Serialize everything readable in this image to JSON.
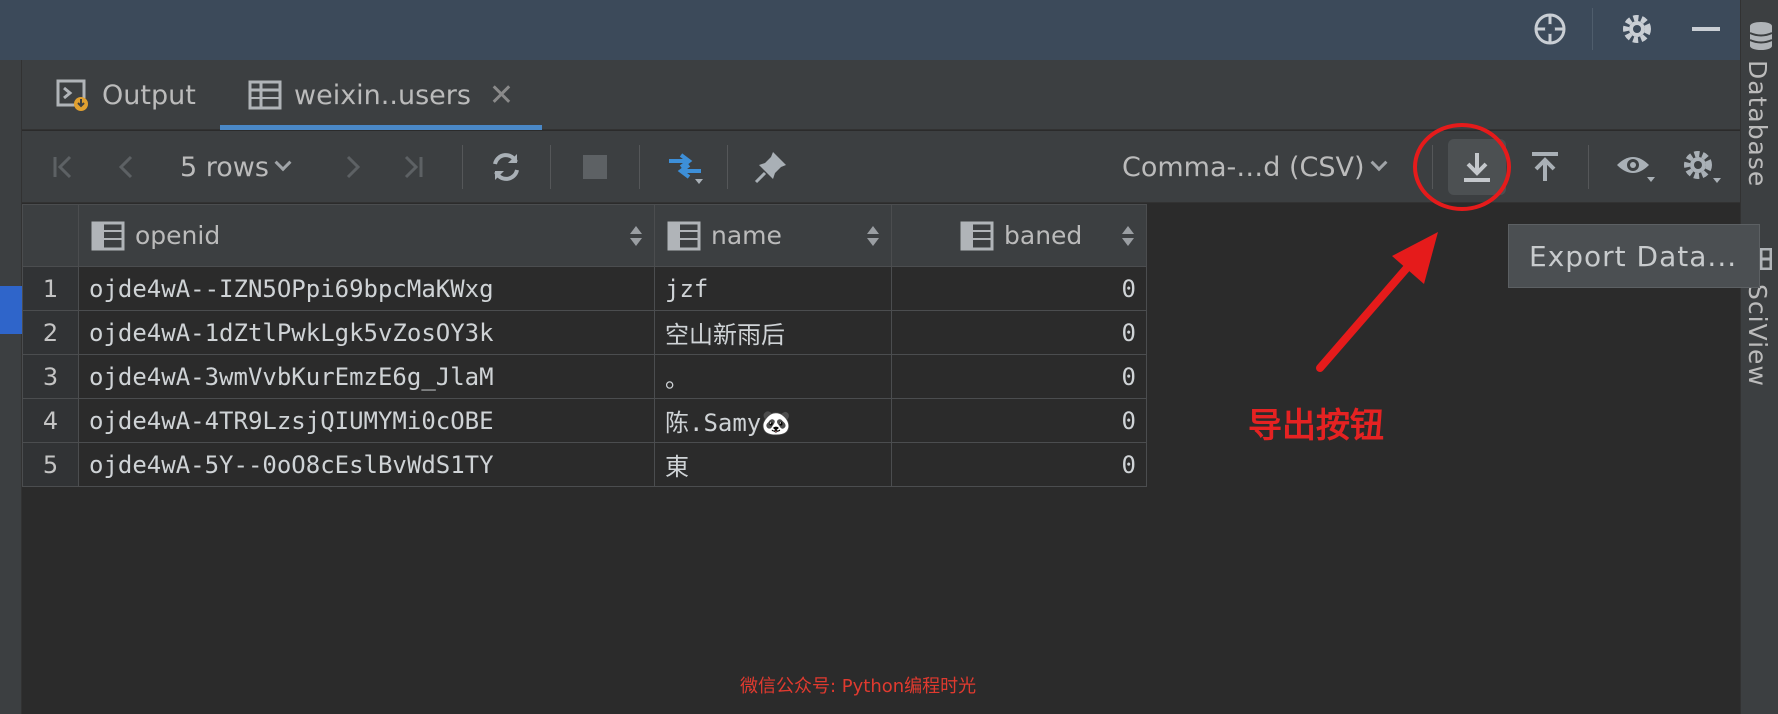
{
  "topbar": {
    "icons": [
      "crosshair-icon",
      "gear-icon",
      "minimize-icon"
    ]
  },
  "right_stripe": {
    "database_label": "Database",
    "sciview_label": "SciView"
  },
  "tabs": [
    {
      "label": "Output",
      "icon": "console-output-icon",
      "active": false
    },
    {
      "label": "weixin..users",
      "icon": "table-icon",
      "active": true,
      "close": "✕"
    }
  ],
  "toolbar": {
    "rows_label": "5 rows",
    "format_label": "Comma-…d (CSV)",
    "icons": [
      "first-page-icon",
      "previous-page-icon",
      "next-page-icon",
      "last-page-icon",
      "refresh-icon",
      "stop-icon",
      "compare-icon",
      "pin-icon",
      "export-icon",
      "import-icon",
      "view-icon",
      "settings-icon"
    ]
  },
  "table": {
    "columns": [
      {
        "label": "openid"
      },
      {
        "label": "name"
      },
      {
        "label": "baned"
      }
    ],
    "rows": [
      {
        "num": "1",
        "openid": "ojde4wA--IZN5OPpi69bpcMaKWxg",
        "name": "jzf",
        "baned": "0"
      },
      {
        "num": "2",
        "openid": "ojde4wA-1dZtlPwkLgk5vZosOY3k",
        "name": "空山新雨后",
        "baned": "0"
      },
      {
        "num": "3",
        "openid": "ojde4wA-3wmVvbKurEmzE6g_JlaM",
        "name": "。",
        "baned": "0"
      },
      {
        "num": "4",
        "openid": "ojde4wA-4TR9LzsjQIUMYMi0cOBE",
        "name": "陈.Samy🐼",
        "baned": "0"
      },
      {
        "num": "5",
        "openid": "ojde4wA-5Y--0oO8cEslBvWdS1TY",
        "name": "東",
        "baned": "0"
      }
    ]
  },
  "tooltip": {
    "label": "Export Data..."
  },
  "annotation": {
    "label": "导出按钮",
    "color": "#e52222"
  },
  "watermark": "微信公众号: Python编程时光",
  "colors": {
    "accent_tab": "#4a88c7",
    "compare_icon": "#3d8fd8"
  }
}
